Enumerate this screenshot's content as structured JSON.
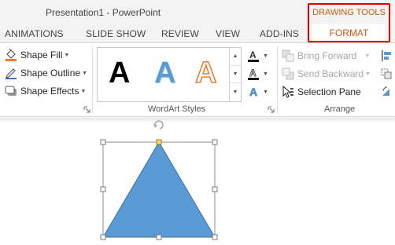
{
  "window": {
    "title": "Presentation1 - PowerPoint"
  },
  "context_tab": {
    "group_label": "DRAWING TOOLS",
    "tab_label": "FORMAT",
    "accent_color": "#c55a11",
    "highlight_color": "#e00000"
  },
  "tabs": [
    {
      "label": "ANIMATIONS"
    },
    {
      "label": "SLIDE SHOW"
    },
    {
      "label": "REVIEW"
    },
    {
      "label": "VIEW"
    },
    {
      "label": "ADD-INS"
    }
  ],
  "shape_styles": {
    "fill": {
      "label": "Shape Fill",
      "icon": "paint-bucket-icon",
      "color": "#ed7d31"
    },
    "outline": {
      "label": "Shape Outline",
      "icon": "pencil-icon",
      "color": "#4472c4"
    },
    "effects": {
      "label": "Shape Effects",
      "icon": "shape-effects-icon"
    }
  },
  "wordart": {
    "group_label": "WordArt Styles",
    "samples": [
      {
        "glyph": "A",
        "style": "black-fill"
      },
      {
        "glyph": "A",
        "style": "blue-gradient"
      },
      {
        "glyph": "A",
        "style": "orange-outline"
      }
    ],
    "tools": [
      {
        "icon": "text-fill-icon"
      },
      {
        "icon": "text-outline-icon"
      },
      {
        "icon": "text-effects-icon"
      }
    ]
  },
  "arrange": {
    "group_label": "Arrange",
    "bring_forward": {
      "label": "Bring Forward",
      "enabled": false
    },
    "send_backward": {
      "label": "Send Backward",
      "enabled": false
    },
    "selection_pane": {
      "label": "Selection Pane",
      "enabled": true
    }
  },
  "slide": {
    "shape": {
      "type": "isosceles-triangle",
      "fill": "#5b9bd5",
      "stroke": "#41719c",
      "selected": true
    }
  }
}
